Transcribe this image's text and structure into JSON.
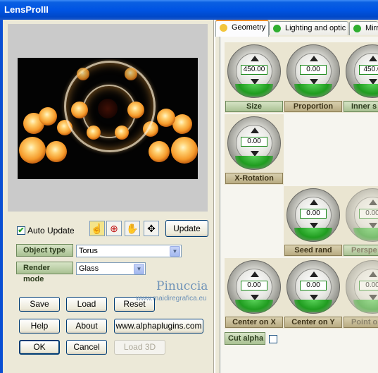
{
  "window": {
    "title": "LensProIII"
  },
  "preview": {
    "auto_update_label": "Auto Update",
    "auto_update_checked": true,
    "update_label": "Update"
  },
  "object_type": {
    "label": "Object type",
    "value": "Torus"
  },
  "render_mode": {
    "label": "Render mode",
    "value": "Glass"
  },
  "buttons": {
    "save": "Save",
    "load": "Load",
    "reset": "Reset",
    "help": "Help",
    "about": "About",
    "website": "www.alphaplugins.com",
    "ok": "OK",
    "cancel": "Cancel",
    "load3d": "Load 3D"
  },
  "tabs": [
    {
      "label": "Geometry",
      "active": true,
      "icon_color": "#f2c53d"
    },
    {
      "label": "Lighting and optic",
      "active": false,
      "icon_color": "#2fae2f"
    },
    {
      "label": "Mirr",
      "active": false,
      "icon_color": "#2fae2f"
    }
  ],
  "controls": {
    "size": {
      "label": "Size",
      "value": "450.00"
    },
    "proportion": {
      "label": "Proportion",
      "value": "0.00"
    },
    "inner_size": {
      "label": "Inner s",
      "value": "450.0"
    },
    "x_rotation": {
      "label": "X-Rotation",
      "value": "0.00"
    },
    "seed_rand": {
      "label": "Seed rand",
      "value": "0.00"
    },
    "perspective": {
      "label": "Perspe",
      "value": "0.00"
    },
    "center_x": {
      "label": "Center on X",
      "value": "0.00"
    },
    "center_y": {
      "label": "Center on Y",
      "value": "0.00"
    },
    "point": {
      "label": "Point o",
      "value": "0.00"
    }
  },
  "cut_alpha": {
    "label": "Cut alpha",
    "checked": false
  },
  "watermark": {
    "name": "Pinuccia",
    "url": "www.maidiregrafica.eu"
  }
}
